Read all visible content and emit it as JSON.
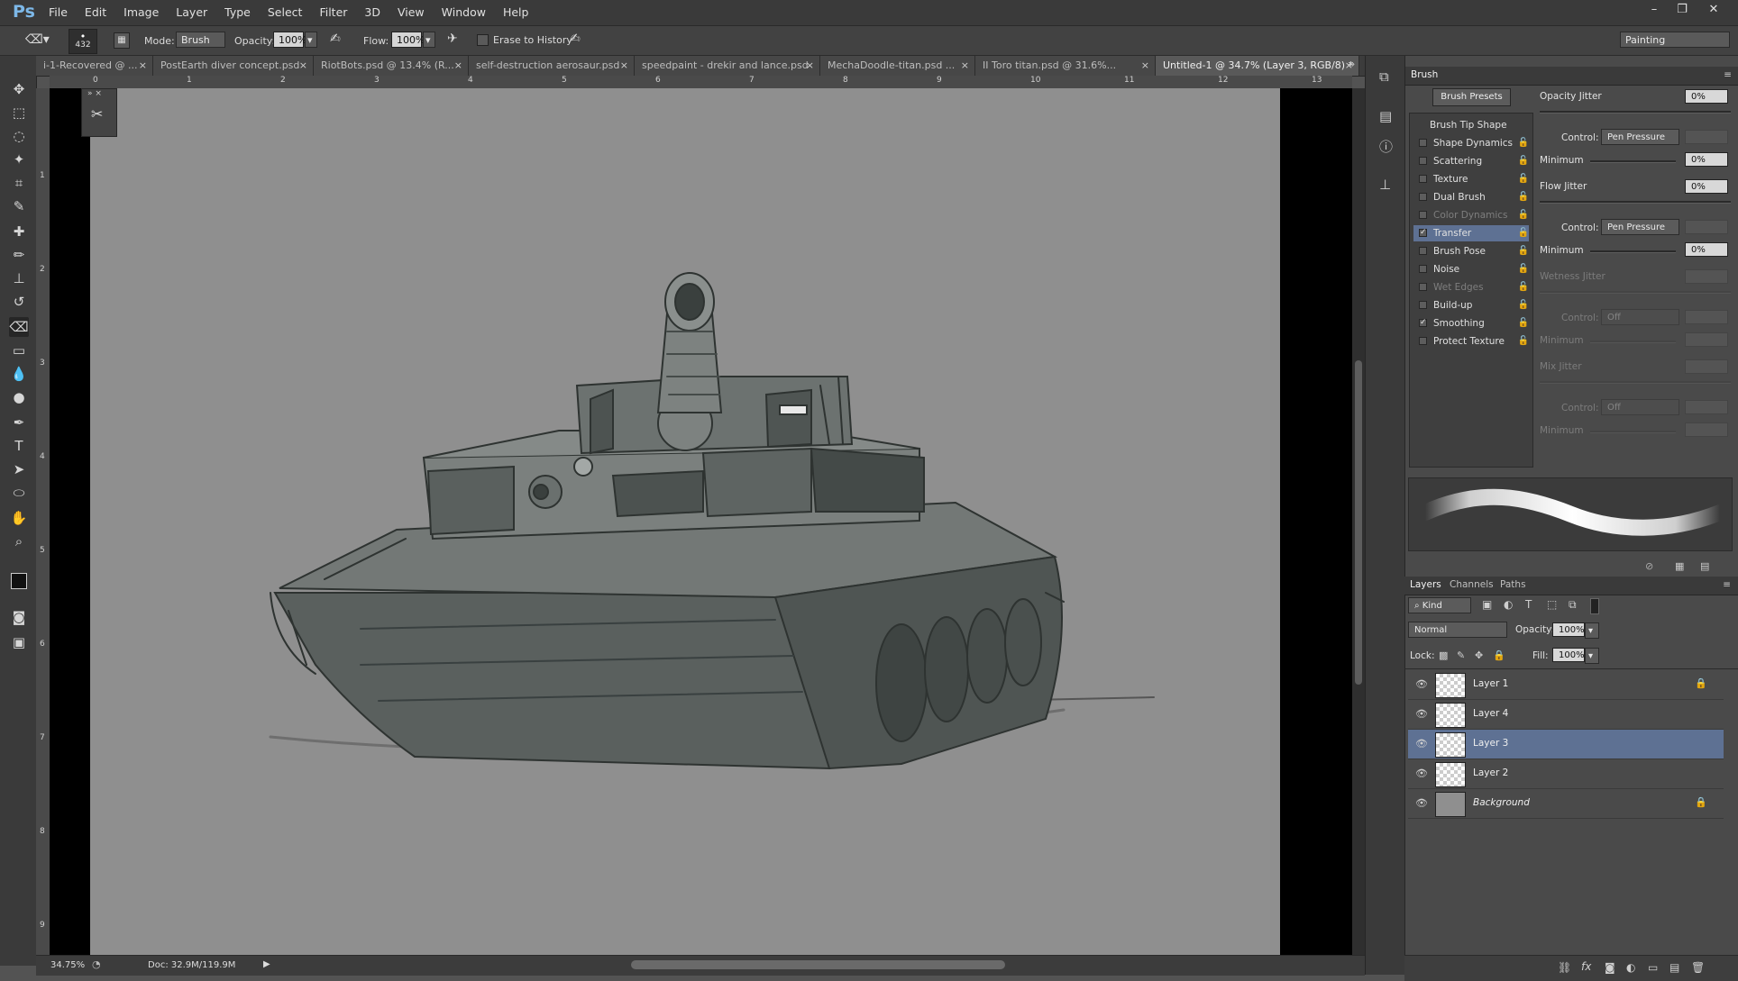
{
  "app": {
    "logo": "Ps"
  },
  "menu": [
    "File",
    "Edit",
    "Image",
    "Layer",
    "Type",
    "Select",
    "Filter",
    "3D",
    "View",
    "Window",
    "Help"
  ],
  "window_controls": {
    "minimize": "–",
    "restore": "❐",
    "close": "✕"
  },
  "options": {
    "brush_size": "432",
    "mode_label": "Mode:",
    "mode_value": "Brush",
    "opacity_label": "Opacity:",
    "opacity_value": "100%",
    "flow_label": "Flow:",
    "flow_value": "100%",
    "erase_history_label": "Erase to History",
    "workspace": "Painting"
  },
  "tabs": [
    {
      "title": "i-1-Recovered @ ..."
    },
    {
      "title": "PostEarth diver concept.psd"
    },
    {
      "title": "RiotBots.psd @ 13.4% (R..."
    },
    {
      "title": "self-destruction aerosaur.psd"
    },
    {
      "title": "speedpaint - drekir and lance.psd"
    },
    {
      "title": "MechaDoodle-titan.psd ..."
    },
    {
      "title": "II Toro titan.psd @ 31.6%..."
    },
    {
      "title": "Untitled-1 @ 34.7% (Layer 3, RGB/8) *"
    }
  ],
  "ruler_h": [
    "0",
    "1",
    "2",
    "3",
    "4",
    "5",
    "6",
    "7",
    "8",
    "9",
    "10",
    "11",
    "12",
    "13"
  ],
  "ruler_v": [
    "1",
    "2",
    "3",
    "4",
    "5",
    "6",
    "7",
    "8",
    "9"
  ],
  "status": {
    "zoom": "34.75%",
    "doc": "Doc: 32.9M/119.9M"
  },
  "brush_panel": {
    "tab": "Brush",
    "presets_button": "Brush Presets",
    "items": [
      {
        "label": "Brush Tip Shape",
        "heading": true
      },
      {
        "label": "Shape Dynamics",
        "checked": false
      },
      {
        "label": "Scattering",
        "checked": false
      },
      {
        "label": "Texture",
        "checked": false
      },
      {
        "label": "Dual Brush",
        "checked": false
      },
      {
        "label": "Color Dynamics",
        "checked": false,
        "dim": true
      },
      {
        "label": "Transfer",
        "checked": true,
        "selected": true
      },
      {
        "label": "Brush Pose",
        "checked": false
      },
      {
        "label": "Noise",
        "checked": false
      },
      {
        "label": "Wet Edges",
        "checked": false,
        "dim": true
      },
      {
        "label": "Build-up",
        "checked": false
      },
      {
        "label": "Smoothing",
        "checked": true
      },
      {
        "label": "Protect Texture",
        "checked": false
      }
    ],
    "opacity_jitter_label": "Opacity Jitter",
    "opacity_jitter_value": "0%",
    "control_label": "Control:",
    "control1": "Pen Pressure",
    "minimum_label": "Minimum",
    "minimum1": "0%",
    "flow_jitter_label": "Flow Jitter",
    "flow_jitter_value": "0%",
    "control2": "Pen Pressure",
    "minimum2": "0%",
    "wetness_jitter_label": "Wetness Jitter",
    "control3": "Off",
    "mix_jitter_label": "Mix Jitter",
    "control4": "Off"
  },
  "layers_panel": {
    "tabs": [
      "Layers",
      "Channels",
      "Paths"
    ],
    "kind_label": "Kind",
    "blend_mode": "Normal",
    "opacity_label": "Opacity:",
    "opacity_value": "100%",
    "lock_label": "Lock:",
    "fill_label": "Fill:",
    "fill_value": "100%",
    "layers": [
      {
        "name": "Layer 1",
        "locked": true
      },
      {
        "name": "Layer 4"
      },
      {
        "name": "Layer 3",
        "selected": true
      },
      {
        "name": "Layer 2"
      },
      {
        "name": "Background",
        "locked": true,
        "italic": true
      }
    ]
  },
  "colors": {
    "accent_selected": "#5e7193",
    "canvas": "#8f8f8f"
  }
}
